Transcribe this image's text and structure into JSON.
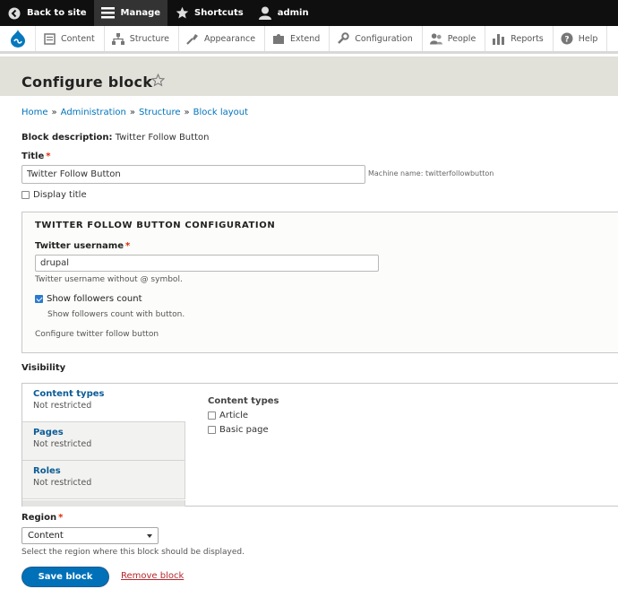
{
  "toolbar": {
    "back_to_site": "Back to site",
    "manage": "Manage",
    "shortcuts": "Shortcuts",
    "user": "admin"
  },
  "tray": {
    "items": [
      {
        "label": "Content",
        "icon": "content-icon"
      },
      {
        "label": "Structure",
        "icon": "structure-icon"
      },
      {
        "label": "Appearance",
        "icon": "appearance-icon"
      },
      {
        "label": "Extend",
        "icon": "extend-icon"
      },
      {
        "label": "Configuration",
        "icon": "wrench-icon"
      },
      {
        "label": "People",
        "icon": "people-icon"
      },
      {
        "label": "Reports",
        "icon": "reports-icon"
      },
      {
        "label": "Help",
        "icon": "help-icon"
      }
    ]
  },
  "page": {
    "title": "Configure block"
  },
  "breadcrumb": {
    "items": [
      "Home",
      "Administration",
      "Structure",
      "Block layout"
    ],
    "separator": "»"
  },
  "block": {
    "description_label": "Block description:",
    "description_value": "Twitter Follow Button"
  },
  "title_field": {
    "label": "Title",
    "required": "*",
    "value": "Twitter Follow Button",
    "machine_name": "Machine name: twitterfollowbutton",
    "display_title_label": "Display title",
    "display_title_checked": false
  },
  "config": {
    "legend": "TWITTER FOLLOW BUTTON CONFIGURATION",
    "username_label": "Twitter username",
    "username_required": "*",
    "username_value": "drupal",
    "username_description": "Twitter username without @ symbol.",
    "followers_label": "Show followers count",
    "followers_checked": true,
    "followers_description": "Show followers count with button.",
    "fieldset_description": "Configure twitter follow button"
  },
  "visibility": {
    "label": "Visibility",
    "tabs": [
      {
        "title": "Content types",
        "summary": "Not restricted",
        "active": true
      },
      {
        "title": "Pages",
        "summary": "Not restricted",
        "active": false
      },
      {
        "title": "Roles",
        "summary": "Not restricted",
        "active": false
      }
    ],
    "pane": {
      "title": "Content types",
      "options": [
        {
          "label": "Article",
          "checked": false
        },
        {
          "label": "Basic page",
          "checked": false
        }
      ]
    }
  },
  "region": {
    "label": "Region",
    "required": "*",
    "selected": "Content",
    "description": "Select the region where this block should be displayed."
  },
  "actions": {
    "save_label": "Save block",
    "remove_label": "Remove block"
  },
  "colors": {
    "toolbar_bg": "#0f0f0f",
    "header_bg": "#e1e0d9",
    "link": "#0074bd",
    "primary_button": "#0071b8",
    "danger_link": "#b8272d",
    "required": "#e32700"
  }
}
